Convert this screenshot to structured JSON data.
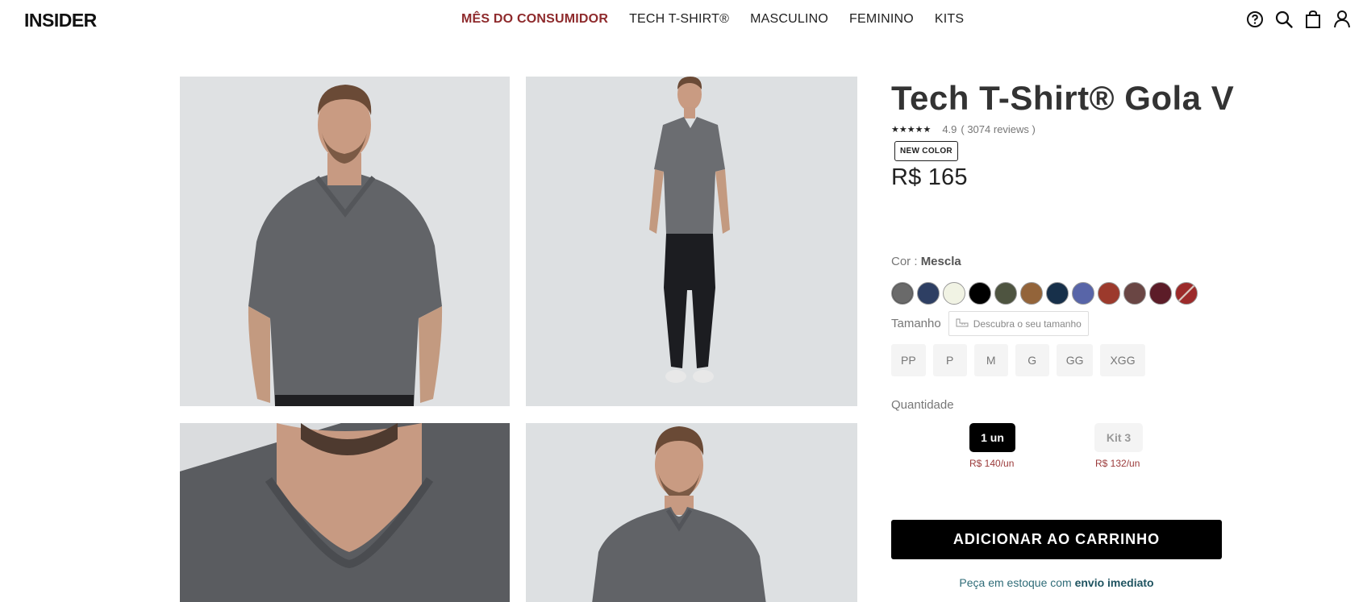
{
  "header": {
    "logo_text": "INSIDER",
    "nav": [
      {
        "label": "MÊS DO CONSUMIDOR"
      },
      {
        "label": "TECH T-SHIRT®"
      },
      {
        "label": "MASCULINO"
      },
      {
        "label": "FEMININO"
      },
      {
        "label": "KITS"
      }
    ],
    "icons": [
      "help-icon",
      "search-icon",
      "bag-icon",
      "user-icon"
    ],
    "promo_color": "#8e2a2c"
  },
  "product": {
    "title": "Tech T-Shirt® Gola V",
    "stars": "★★★★★",
    "rating": "4.9",
    "reviews": "( 3074 reviews )",
    "badge": "NEW COLOR",
    "price": "R$ 165",
    "color_label": "Cor :",
    "color_value": "Mescla",
    "colors": [
      "#6a6a6a",
      "#2e3f63",
      "#f1f3e4",
      "#000000",
      "#4e5440",
      "#93643a",
      "#17304a",
      "#5865a8",
      "#9c3a2c",
      "#6a4644",
      "#5c1c28",
      "#9c2a2a"
    ],
    "size_label": "Tamanho",
    "size_guide": "Descubra o seu tamanho",
    "sizes": [
      "PP",
      "P",
      "M",
      "G",
      "GG",
      "XGG"
    ],
    "quantity_label": "Quantidade",
    "quantity_options": [
      {
        "label": "1 un",
        "price": "R$ 140/un",
        "selected": true
      },
      {
        "label": "Kit 3",
        "price": "R$ 132/un",
        "selected": false
      }
    ],
    "add_to_cart": "ADICIONAR AO CARRINHO",
    "stock_text": "Peça em estoque com",
    "stock_highlight": "envio imediato"
  }
}
